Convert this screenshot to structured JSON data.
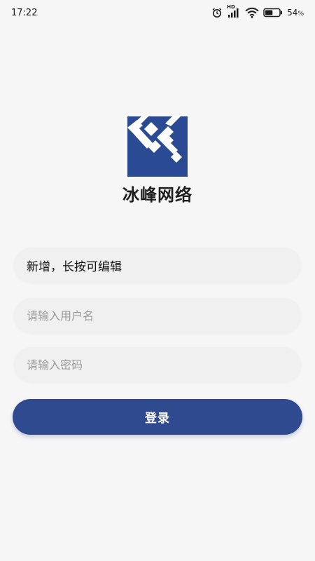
{
  "status_bar": {
    "time": "17:22",
    "network_type": "HD",
    "battery_percent": "54",
    "battery_unit": "%",
    "icons": [
      "alarm-icon",
      "signal-icon",
      "wifi-icon",
      "battery-icon"
    ]
  },
  "logo": {
    "letters": "T.F.",
    "background_color": "#2b4a94"
  },
  "app": {
    "name": "冰峰网络"
  },
  "form": {
    "server_value": "新增，长按可编辑",
    "username_placeholder": "请输入用户名",
    "password_placeholder": "请输入密码",
    "login_label": "登录"
  },
  "colors": {
    "primary": "#2f4a8f",
    "background": "#f6f6f7",
    "field_background": "#f0f0f1",
    "placeholder": "#9a9a9a"
  }
}
